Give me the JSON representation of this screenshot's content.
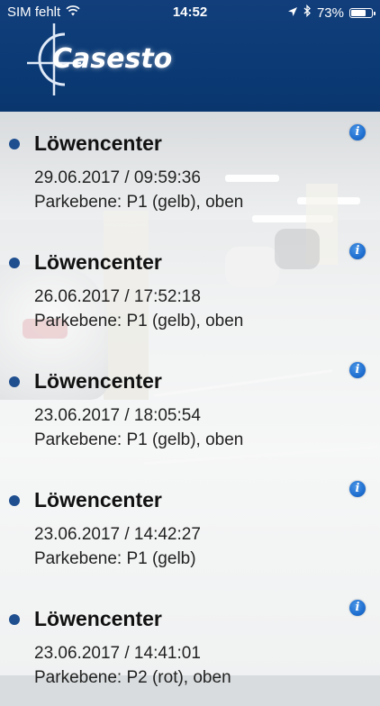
{
  "status_bar": {
    "carrier": "SIM fehlt",
    "time": "14:52",
    "battery_percent": "73%",
    "battery_level": 0.73
  },
  "header": {
    "logo_text": "Casesto",
    "background_color": "#0b3a75"
  },
  "entries": [
    {
      "title": "Löwencenter",
      "datetime": "29.06.2017 / 09:59:36",
      "location": "Parkebene: P1 (gelb), oben"
    },
    {
      "title": "Löwencenter",
      "datetime": "26.06.2017 / 17:52:18",
      "location": "Parkebene: P1 (gelb), oben"
    },
    {
      "title": "Löwencenter",
      "datetime": "23.06.2017 / 18:05:54",
      "location": "Parkebene: P1 (gelb), oben"
    },
    {
      "title": "Löwencenter",
      "datetime": "23.06.2017 / 14:42:27",
      "location": "Parkebene: P1 (gelb)"
    },
    {
      "title": "Löwencenter",
      "datetime": "23.06.2017 / 14:41:01",
      "location": "Parkebene: P2 (rot), oben"
    }
  ],
  "icons": {
    "info": "info-icon",
    "bullet": "bullet-dot"
  },
  "colors": {
    "accent": "#1f4f8f",
    "info": "#1f6fd0"
  }
}
